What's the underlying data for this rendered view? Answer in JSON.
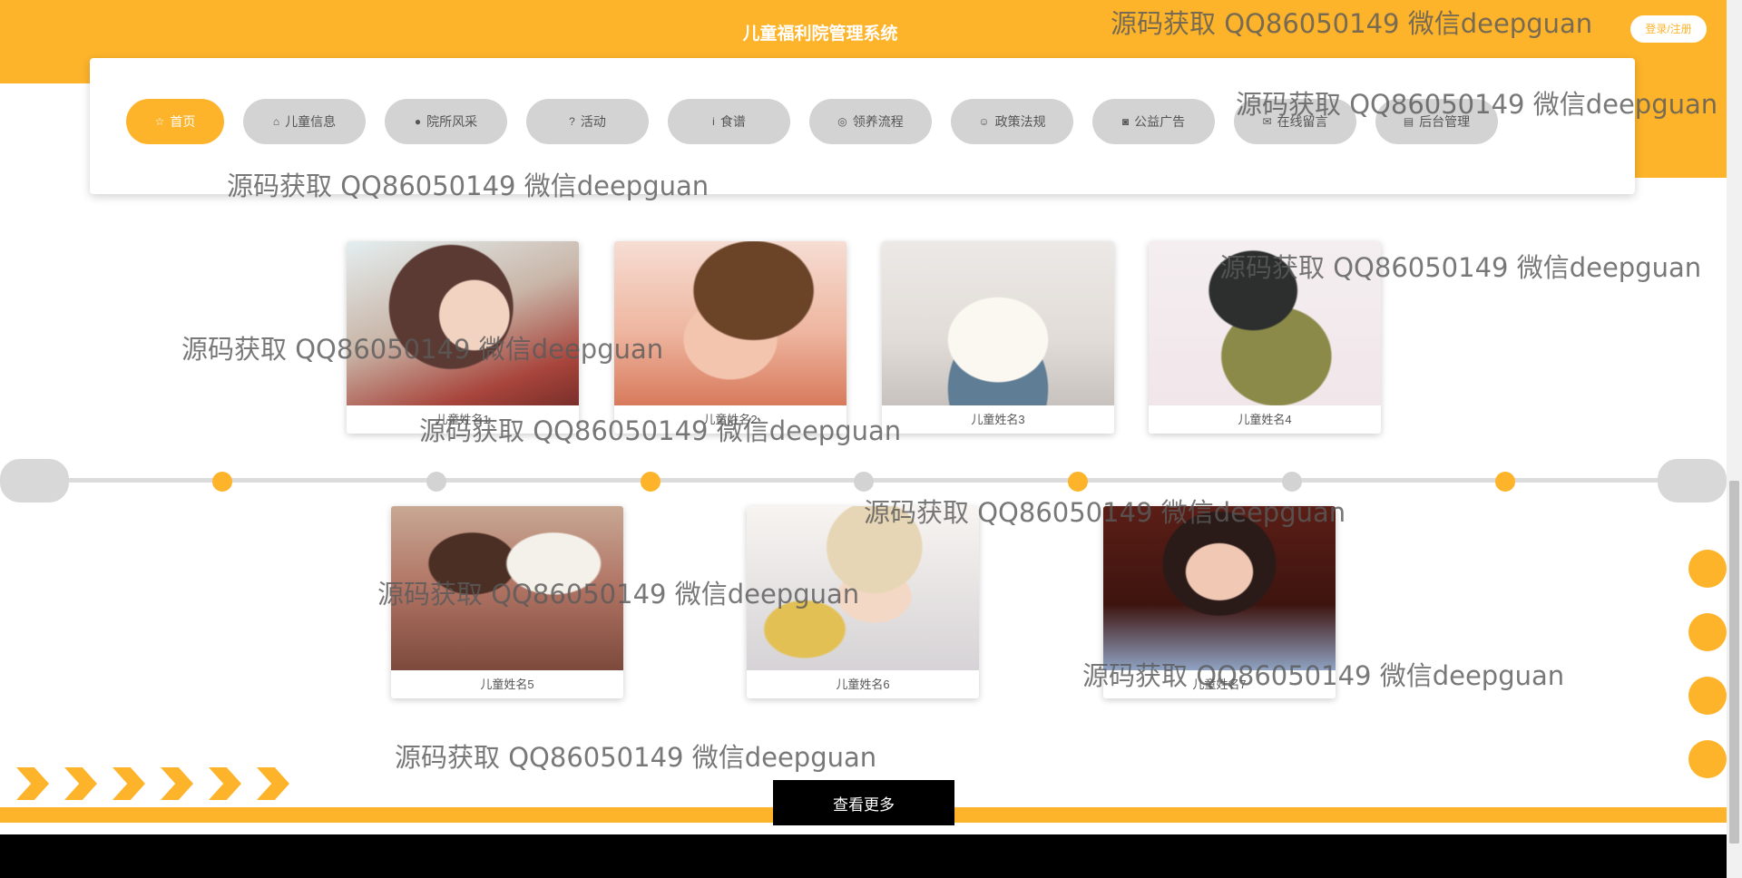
{
  "header": {
    "title": "儿童福利院管理系统",
    "login_label": "登录/注册"
  },
  "nav": {
    "items": [
      {
        "label": "首页",
        "icon": "☆"
      },
      {
        "label": "儿童信息",
        "icon": "⌂"
      },
      {
        "label": "院所风采",
        "icon": "●"
      },
      {
        "label": "活动",
        "icon": "?"
      },
      {
        "label": "食谱",
        "icon": "i"
      },
      {
        "label": "领养流程",
        "icon": "◎"
      },
      {
        "label": "政策法规",
        "icon": "☺"
      },
      {
        "label": "公益广告",
        "icon": "◙"
      },
      {
        "label": "在线留言",
        "icon": "✉"
      },
      {
        "label": "后台管理",
        "icon": "▤"
      }
    ]
  },
  "children": [
    {
      "name": "儿童姓名1"
    },
    {
      "name": "儿童姓名2"
    },
    {
      "name": "儿童姓名3"
    },
    {
      "name": "儿童姓名4"
    },
    {
      "name": "儿童姓名5"
    },
    {
      "name": "儿童姓名6"
    },
    {
      "name": "儿童姓名7"
    }
  ],
  "more_button": "查看更多",
  "watermark": "源码获取 QQ86050149 微信deepguan",
  "colors": {
    "accent": "#fdb42b",
    "inactive": "#d3d3d3",
    "footer": "#000000"
  }
}
